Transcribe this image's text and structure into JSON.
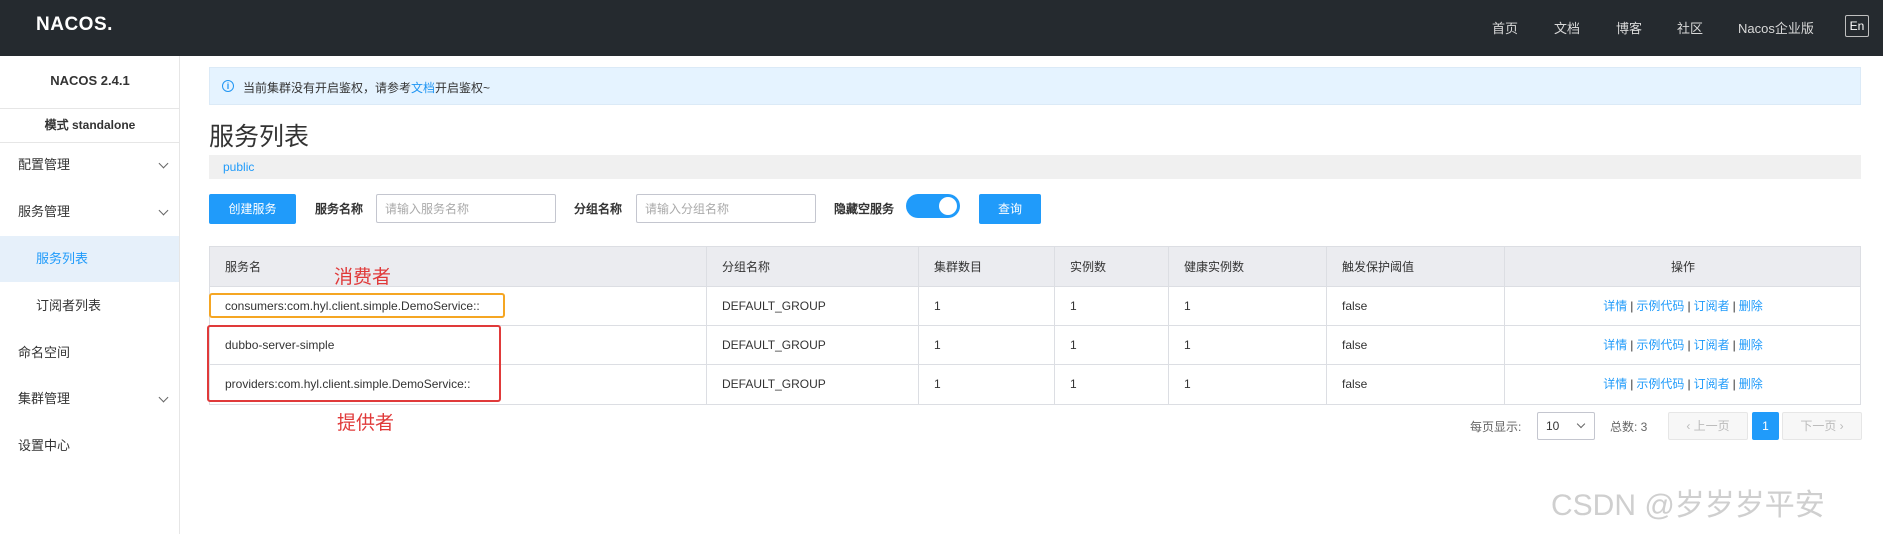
{
  "topbar": {
    "logo": "NACOS.",
    "nav": [
      "首页",
      "文档",
      "博客",
      "社区",
      "Nacos企业版"
    ],
    "lang": "En"
  },
  "sidebar": {
    "version": "NACOS 2.4.1",
    "mode": "模式 standalone",
    "items": [
      {
        "label": "配置管理"
      },
      {
        "label": "服务管理"
      },
      {
        "label": "服务列表"
      },
      {
        "label": "订阅者列表"
      },
      {
        "label": "命名空间"
      },
      {
        "label": "集群管理"
      },
      {
        "label": "设置中心"
      }
    ]
  },
  "notice": {
    "prefix": "当前集群没有开启鉴权，请参考",
    "link": "文档",
    "suffix": "开启鉴权~"
  },
  "page": {
    "title": "服务列表",
    "namespace": "public"
  },
  "filters": {
    "create_label": "创建服务",
    "service_name_label": "服务名称",
    "service_name_placeholder": "请输入服务名称",
    "group_name_label": "分组名称",
    "group_name_placeholder": "请输入分组名称",
    "hide_empty_label": "隐藏空服务",
    "hide_empty_on": true,
    "query_label": "查询"
  },
  "table": {
    "headers": [
      "服务名",
      "分组名称",
      "集群数目",
      "实例数",
      "健康实例数",
      "触发保护阈值",
      "操作"
    ],
    "rows": [
      {
        "name": "consumers:com.hyl.client.simple.DemoService::",
        "group": "DEFAULT_GROUP",
        "clusters": "1",
        "instances": "1",
        "healthy": "1",
        "threshold": "false"
      },
      {
        "name": "dubbo-server-simple",
        "group": "DEFAULT_GROUP",
        "clusters": "1",
        "instances": "1",
        "healthy": "1",
        "threshold": "false"
      },
      {
        "name": "providers:com.hyl.client.simple.DemoService::",
        "group": "DEFAULT_GROUP",
        "clusters": "1",
        "instances": "1",
        "healthy": "1",
        "threshold": "false"
      }
    ],
    "ops": {
      "detail": "详情",
      "sample": "示例代码",
      "subscriber": "订阅者",
      "delete": "删除",
      "sep": "|"
    }
  },
  "annotations": {
    "consumer": "消费者",
    "provider": "提供者"
  },
  "pagination": {
    "page_size_label": "每页显示:",
    "page_size": "10",
    "total_label": "总数: 3",
    "prev": "上一页",
    "current": "1",
    "next": "下一页"
  },
  "watermark": "CSDN @岁岁岁平安",
  "colors": {
    "primary": "#209bfa",
    "topbar": "#252a2f",
    "annotation_red": "#e03a3a",
    "annotation_orange": "#f5a623"
  }
}
